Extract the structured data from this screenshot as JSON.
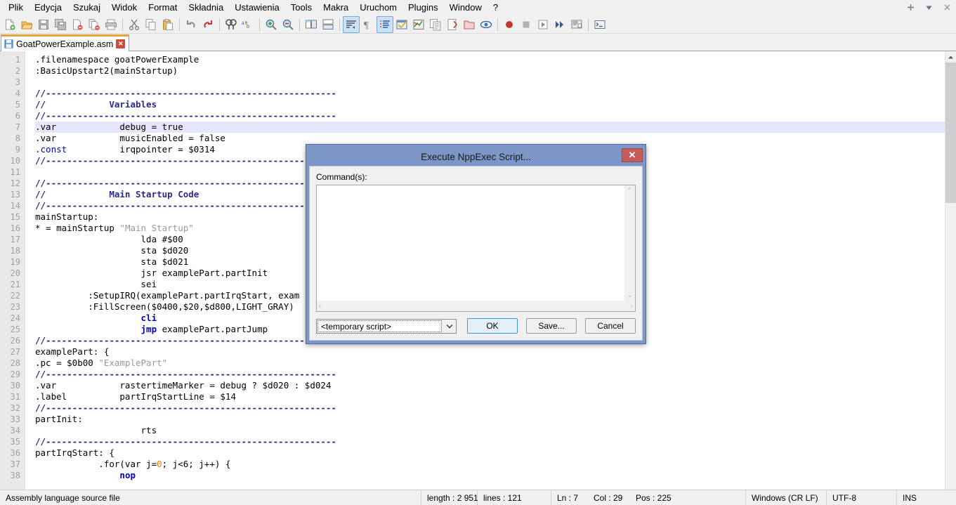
{
  "menubar": {
    "items": [
      {
        "label": "Plik"
      },
      {
        "label": "Edycja"
      },
      {
        "label": "Szukaj"
      },
      {
        "label": "Widok"
      },
      {
        "label": "Format"
      },
      {
        "label": "Składnia"
      },
      {
        "label": "Ustawienia"
      },
      {
        "label": "Tools"
      },
      {
        "label": "Makra"
      },
      {
        "label": "Uruchom"
      },
      {
        "label": "Plugins"
      },
      {
        "label": "Window"
      },
      {
        "label": "?"
      }
    ],
    "window_controls": [
      {
        "name": "add-tab-button",
        "glyph": "+"
      },
      {
        "name": "dropdown-button",
        "glyph": "▼"
      },
      {
        "name": "close-button",
        "glyph": "✕"
      }
    ]
  },
  "toolbar": {
    "buttons": [
      {
        "name": "new-file",
        "label": "New"
      },
      {
        "name": "open-file",
        "label": "Open"
      },
      {
        "name": "save-file",
        "label": "Save"
      },
      {
        "name": "save-all",
        "label": "Save All"
      },
      {
        "name": "close-file",
        "label": "Close"
      },
      {
        "name": "close-all",
        "label": "Close All"
      },
      {
        "name": "print",
        "label": "Print"
      },
      {
        "name": "cut",
        "label": "Cut"
      },
      {
        "name": "copy",
        "label": "Copy"
      },
      {
        "name": "paste",
        "label": "Paste"
      },
      {
        "name": "undo",
        "label": "Undo"
      },
      {
        "name": "redo",
        "label": "Redo"
      },
      {
        "name": "find",
        "label": "Find"
      },
      {
        "name": "replace",
        "label": "Replace"
      },
      {
        "name": "zoom-in",
        "label": "Zoom In"
      },
      {
        "name": "zoom-out",
        "label": "Zoom Out"
      },
      {
        "name": "sync-vertical-scroll",
        "label": "Sync Vertical Scrolling"
      },
      {
        "name": "sync-horizontal-scroll",
        "label": "Sync Horizontal Scrolling"
      },
      {
        "name": "word-wrap",
        "label": "Word Wrap",
        "active": true
      },
      {
        "name": "show-all-characters",
        "label": "Show All Characters"
      },
      {
        "name": "indent-guide",
        "label": "Indent Guide",
        "active": true
      },
      {
        "name": "user-defined-dialog",
        "label": "User Defined Dialogue"
      },
      {
        "name": "document-map",
        "label": "Document Map"
      },
      {
        "name": "function-list",
        "label": "Function List"
      },
      {
        "name": "document-list",
        "label": "Document List"
      },
      {
        "name": "folder-as-workspace",
        "label": "Folder as Workspace"
      },
      {
        "name": "monitoring",
        "label": "Monitoring"
      },
      {
        "name": "record-macro",
        "label": "Start Recording"
      },
      {
        "name": "stop-macro",
        "label": "Stop Recording"
      },
      {
        "name": "play-macro",
        "label": "Playback"
      },
      {
        "name": "run-macro-multiple",
        "label": "Run a Macro Multiple Times"
      },
      {
        "name": "save-macro",
        "label": "Save Current Recorded Macro"
      },
      {
        "name": "run",
        "label": "Run"
      }
    ]
  },
  "tabs": [
    {
      "label": "GoatPowerExample.asm",
      "active": true,
      "close_glyph": "✕"
    }
  ],
  "editor": {
    "current_line": 7,
    "first_line_number": 1,
    "lines": [
      {
        "n": 1,
        "html": ".filenamespace goatPowerExample"
      },
      {
        "n": 2,
        "html": ":BasicUpstart2(mainStartup)"
      },
      {
        "n": 3,
        "html": ""
      },
      {
        "n": 4,
        "html": "<span class='c-comment'>//-------------------------------------------------------</span>"
      },
      {
        "n": 5,
        "html": "<span class='c-comment'>//            Variables</span>"
      },
      {
        "n": 6,
        "html": "<span class='c-comment'>//-------------------------------------------------------</span>"
      },
      {
        "n": 7,
        "html": ".var            debug = true"
      },
      {
        "n": 8,
        "html": ".var            musicEnabled = false"
      },
      {
        "n": 9,
        "html": "<span class='c-dir'>.const</span>          irqpointer = $0314"
      },
      {
        "n": 10,
        "html": "<span class='c-comment'>//-------------------------------------------------------</span>"
      },
      {
        "n": 11,
        "html": ""
      },
      {
        "n": 12,
        "html": "<span class='c-comment'>//-------------------------------------------------------</span>"
      },
      {
        "n": 13,
        "html": "<span class='c-comment'>//            Main Startup Code</span>"
      },
      {
        "n": 14,
        "html": "<span class='c-comment'>//-------------------------------------------------------</span>"
      },
      {
        "n": 15,
        "html": "mainStartup:"
      },
      {
        "n": 16,
        "html": "* = mainStartup <span class='c-str'>\"Main Startup\"</span>"
      },
      {
        "n": 17,
        "html": "                    lda #$00"
      },
      {
        "n": 18,
        "html": "                    sta $d020"
      },
      {
        "n": 19,
        "html": "                    sta $d021"
      },
      {
        "n": 20,
        "html": "                    jsr examplePart.partInit"
      },
      {
        "n": 21,
        "html": "                    sei"
      },
      {
        "n": 22,
        "html": "          :SetupIRQ(examplePart.partIrqStart, exam"
      },
      {
        "n": 23,
        "html": "          :FillScreen($0400,$20,$d800,LIGHT_GRAY)"
      },
      {
        "n": 24,
        "html": "                    <span class='c-kw'>cli</span>"
      },
      {
        "n": 25,
        "html": "                    <span class='c-kw'>jmp</span> examplePart.partJump"
      },
      {
        "n": 26,
        "html": "<span class='c-comment'>//-------------------------------------------------------</span>"
      },
      {
        "n": 27,
        "html": "examplePart: {"
      },
      {
        "n": 28,
        "html": ".pc = $0b00 <span class='c-str'>\"ExamplePart\"</span>"
      },
      {
        "n": 29,
        "html": "<span class='c-comment'>//-------------------------------------------------------</span>"
      },
      {
        "n": 30,
        "html": ".var            rastertimeMarker = debug ? $d020 : $d024"
      },
      {
        "n": 31,
        "html": ".label          partIrqStartLine = $14"
      },
      {
        "n": 32,
        "html": "<span class='c-comment'>//-------------------------------------------------------</span>"
      },
      {
        "n": 33,
        "html": "partInit:"
      },
      {
        "n": 34,
        "html": "                    rts"
      },
      {
        "n": 35,
        "html": "<span class='c-comment'>//-------------------------------------------------------</span>"
      },
      {
        "n": 36,
        "html": "partIrqStart: {"
      },
      {
        "n": 37,
        "html": "            .for(var j=<span class='c-num'>0</span>; j&lt;6; j++) {"
      },
      {
        "n": 38,
        "html": "                <span class='c-kw'>nop</span>"
      }
    ]
  },
  "dialog": {
    "title": "Execute NppExec Script...",
    "close_glyph": "✕",
    "command_label": "Command(s):",
    "command_value": "",
    "script_combo_value": "<temporary script>",
    "combo_arrow_glyph": "⌄",
    "buttons": {
      "ok": "OK",
      "save": "Save...",
      "cancel": "Cancel"
    },
    "scroll": {
      "up_glyph": "⌃",
      "down_glyph": "⌄",
      "left_glyph": "‹",
      "right_glyph": "›"
    }
  },
  "statusbar": {
    "file_type": "Assembly language source file",
    "length": "length : 2 951",
    "lines": "lines : 121",
    "ln": "Ln : 7",
    "col": "Col : 29",
    "pos": "Pos : 225",
    "eol": "Windows (CR LF)",
    "encoding": "UTF-8",
    "insert_mode": "INS"
  },
  "colors": {
    "dialog_border": "#7c96c8",
    "tab_accent": "#e8a33d",
    "current_line": "#e6e6fa",
    "toolbar_active": "#cbe2f7",
    "close_red": "#c75b5b"
  }
}
